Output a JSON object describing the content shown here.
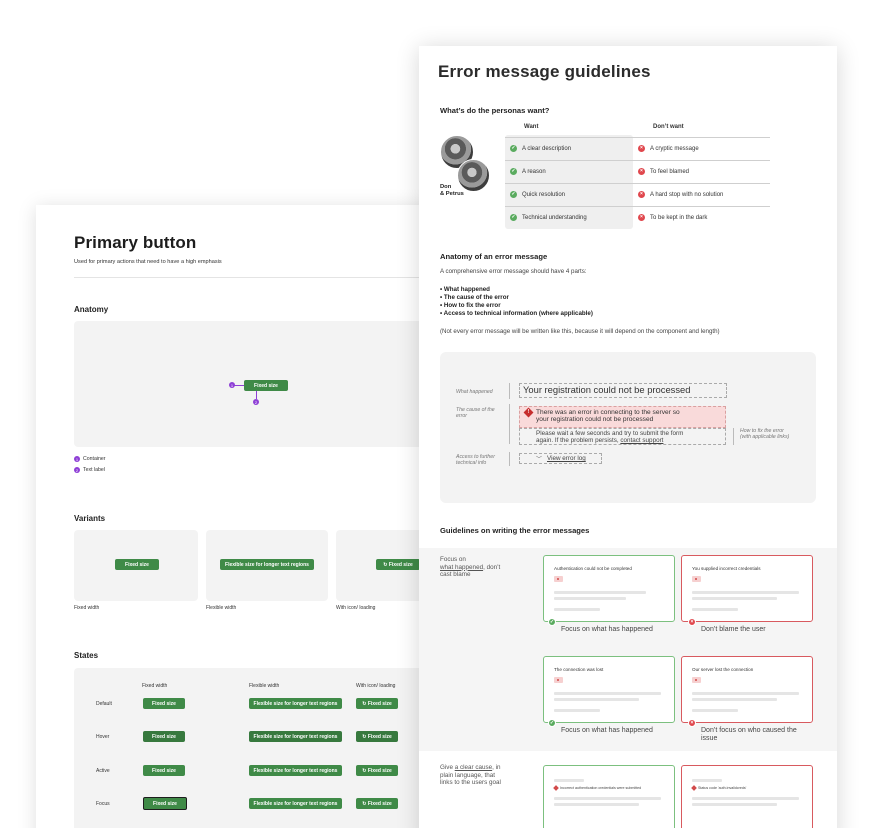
{
  "primary": {
    "title": "Primary button",
    "subtitle": "Used for primary actions that need to have a high emphasis",
    "anatomy": {
      "heading": "Anatomy",
      "button_label": "Fixed size",
      "marker_1": "1",
      "marker_2": "2",
      "legend": [
        "Container",
        "Text label"
      ]
    },
    "variants": {
      "heading": "Variants",
      "buttons": [
        "Fixed size",
        "Flexible size for longer text regions",
        "Fixed size"
      ],
      "labels": [
        "Fixed width",
        "Flexible width",
        "With icon/ loading"
      ]
    },
    "states": {
      "heading": "States",
      "columns": [
        "Fixed width",
        "Flexible width",
        "With icon/ loading"
      ],
      "rows": [
        "Default",
        "Hover",
        "Active",
        "Focus"
      ],
      "fixed_label": "Fixed size",
      "flex_label": "Flexible size for longer text regions",
      "icon_label": "Fixed size"
    }
  },
  "guidelines": {
    "title": "Error message guidelines",
    "personas": {
      "heading": "What’s do the personas want?",
      "name_line1": "Don",
      "name_line2": "& Petrus",
      "want_header": "Want",
      "dont_header": "Don’t want",
      "rows": [
        {
          "want": "A clear description",
          "dont": "A cryptic message"
        },
        {
          "want": "A reason",
          "dont": "To feel blamed"
        },
        {
          "want": "Quick resolution",
          "dont": "A hard stop with no solution"
        },
        {
          "want": "Technical understanding",
          "dont": "To be kept in the dark"
        }
      ]
    },
    "anatomy": {
      "heading": "Anatomy of an error message",
      "intro": "A comprehensive error message should have 4 parts:",
      "parts": [
        "What happened",
        "The cause of the error",
        "How to fix the error",
        "Access to technical information (where applicable)"
      ],
      "note": "(Not every error message will be written like this, because it will depend on the component and length)",
      "lbl_what": "What happened",
      "lbl_cause_1": "The cause of the",
      "lbl_cause_2": "error",
      "lbl_access_1": "Access to further",
      "lbl_access_2": "technical info",
      "lbl_fix_1": "How to fix the error",
      "lbl_fix_2": "(with applicable links)",
      "headline": "Your registration could not be processed",
      "cause_1": "There was an error in connecting to the server so",
      "cause_2": "your registration could not be processed",
      "help_1": "Please wait a few seconds and try to submit the form",
      "help_2": "again. If the problem persists,",
      "help_link": "contact support",
      "log_button": "View error log"
    },
    "writing": {
      "heading": "Guidelines on writing the error messages",
      "focus_1": "Focus on",
      "focus_link": "what happened",
      "focus_2": ", don’t",
      "focus_3": "cast blame",
      "examples": [
        {
          "title": "Authentication could not be completed",
          "caption": "Focus on what has happened"
        },
        {
          "title": "You supplied incorrect credentials",
          "caption": "Don’t blame the user"
        },
        {
          "title": "The connection was lost",
          "caption": "Focus on what has happened"
        },
        {
          "title": "Our server lost the connection",
          "caption_1": "Don’t focus on who caused the",
          "caption_2": "issue"
        }
      ],
      "cause_1": "Give",
      "cause_link": "a clear cause",
      "cause_2": ", in",
      "cause_3": "plain language, that",
      "cause_4": "links to the users goal",
      "inline_good": "Incorrect authentication credentials were submitted",
      "inline_bad": "Status code 'auth.invalidcreds'"
    }
  },
  "colors": {
    "button_green": "#3f8a47",
    "marker_purple": "#8e3fd6",
    "success": "#5aab5f",
    "error": "#e0474d"
  }
}
